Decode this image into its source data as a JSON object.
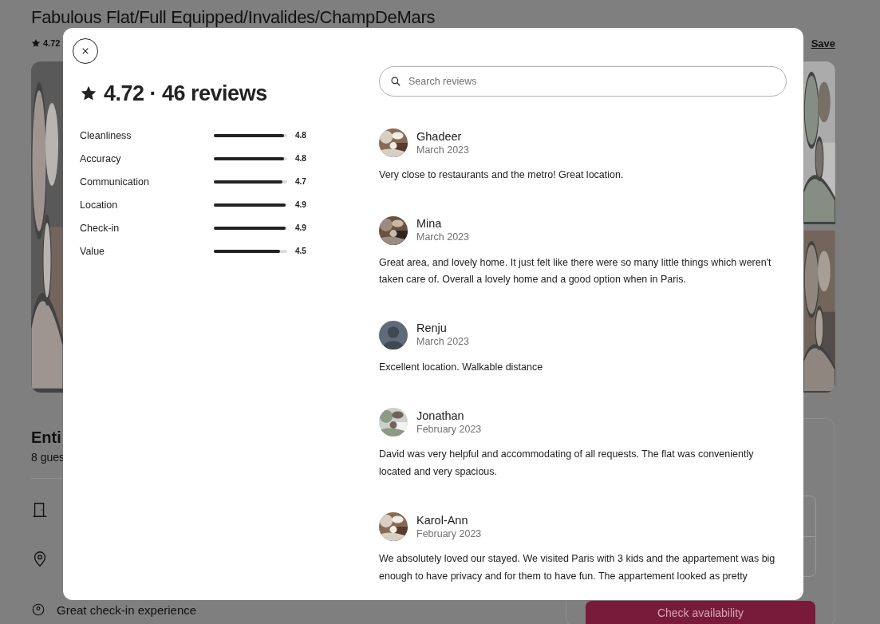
{
  "listing": {
    "title": "Fabulous Flat/Full Equipped/Invalides/ChampDeMars",
    "rating": "4.72",
    "save": "Save",
    "heading": "Enti",
    "subtitle": "8 gues",
    "highlight": "Great check-in experience",
    "book_button": "Check availability"
  },
  "reviews_dialog": {
    "heading": "4.72 · 46 reviews",
    "categories": [
      {
        "name": "Cleanliness",
        "level": 0.96,
        "score": "4.8"
      },
      {
        "name": "Accuracy",
        "level": 0.96,
        "score": "4.8"
      },
      {
        "name": "Communication",
        "level": 0.94,
        "score": "4.7"
      },
      {
        "name": "Location",
        "level": 0.98,
        "score": "4.9"
      },
      {
        "name": "Check-in",
        "level": 0.98,
        "score": "4.9"
      },
      {
        "name": "Value",
        "level": 0.9,
        "score": "4.5"
      }
    ],
    "search": {
      "placeholder": "Search reviews"
    },
    "reviews": [
      {
        "name": "Ghadeer",
        "date": "March 2023",
        "kind": "picture",
        "text": "Very close to restaurants and the metro! Great location."
      },
      {
        "name": "Mina",
        "date": "March 2023",
        "kind": "picture",
        "text": "Great area, and lovely home. It just felt like there were so many little things which weren't taken care of. Overall a lovely home and a good option when in Paris."
      },
      {
        "name": "Renju",
        "date": "March 2023",
        "kind": "default",
        "text": "Excellent location. Walkable distance"
      },
      {
        "name": "Jonathan",
        "date": "February 2023",
        "kind": "picture",
        "text": "David was very helpful and accommodating of all requests. The flat was conveniently located and very spacious."
      },
      {
        "name": "Karol-Ann",
        "date": "February 2023",
        "kind": "picture",
        "text": "We absolutely loved our stayed. We visited Paris with 3 kids and the appartement was big enough to have privacy and for them to have fun. The appartement looked as pretty"
      }
    ]
  }
}
